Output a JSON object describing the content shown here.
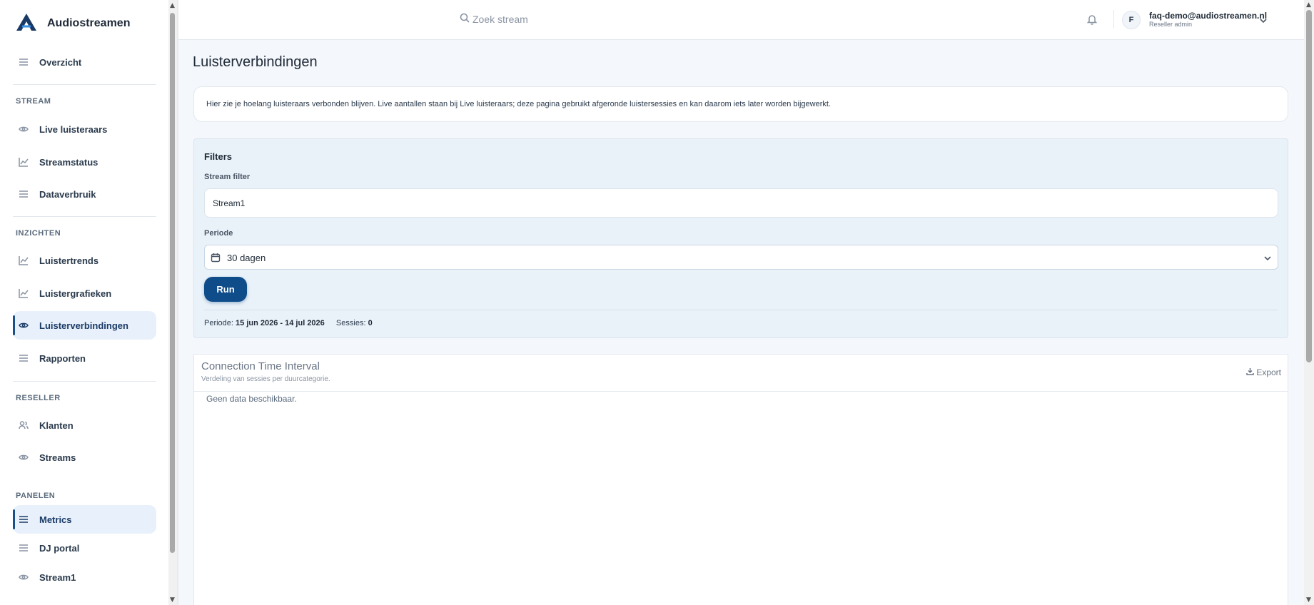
{
  "brand": {
    "name": "Audiostreamen"
  },
  "sidebar": {
    "overview": {
      "label": "Overzicht",
      "icon": "menu-icon"
    },
    "sections": {
      "stream": "STREAM",
      "inzichten": "INZICHTEN",
      "reseller": "RESELLER",
      "panelen": "PANELEN"
    },
    "items": [
      {
        "label": "Live luisteraars",
        "icon": "eye-icon"
      },
      {
        "label": "Streamstatus",
        "icon": "line-chart-icon"
      },
      {
        "label": "Dataverbruik",
        "icon": "menu-icon"
      },
      {
        "label": "Luistertrends",
        "icon": "line-chart-icon"
      },
      {
        "label": "Luistergrafieken",
        "icon": "line-chart-icon"
      },
      {
        "label": "Luisterverbindingen",
        "icon": "eye-icon",
        "active": true
      },
      {
        "label": "Rapporten",
        "icon": "menu-icon"
      },
      {
        "label": "Klanten",
        "icon": "users-icon"
      },
      {
        "label": "Streams",
        "icon": "eye-icon"
      },
      {
        "label": "Metrics",
        "icon": "menu-icon",
        "active": true
      },
      {
        "label": "DJ portal",
        "icon": "menu-icon"
      },
      {
        "label": "Stream1",
        "icon": "eye-icon"
      }
    ]
  },
  "topbar": {
    "search_placeholder": "Zoek stream",
    "avatar_initial": "F",
    "user_email": "faq-demo@audiostreamen.nl",
    "user_role": "Reseller admin"
  },
  "main": {
    "title": "Luisterverbindingen",
    "info": "Hier zie je hoelang luisteraars verbonden blijven. Live aantallen staan bij Live luisteraars; deze pagina gebruikt afgeronde luistersessies en kan daarom iets later worden bijgewerkt.",
    "filters": {
      "title": "Filters",
      "stream_label": "Stream filter",
      "stream_value": "Stream1",
      "period_label": "Periode",
      "period_value": "30 dagen",
      "run_label": "Run",
      "meta_period_label": "Periode:",
      "meta_period_value": "15 jun 2026 - 14 jul 2026",
      "meta_sessions_label": "Sessies:",
      "meta_sessions_value": "0"
    },
    "chart": {
      "title": "Connection Time Interval",
      "subtitle": "Verdeling van sessies per duurcategorie.",
      "export_label": "Export",
      "empty": "Geen data beschikbaar."
    }
  }
}
